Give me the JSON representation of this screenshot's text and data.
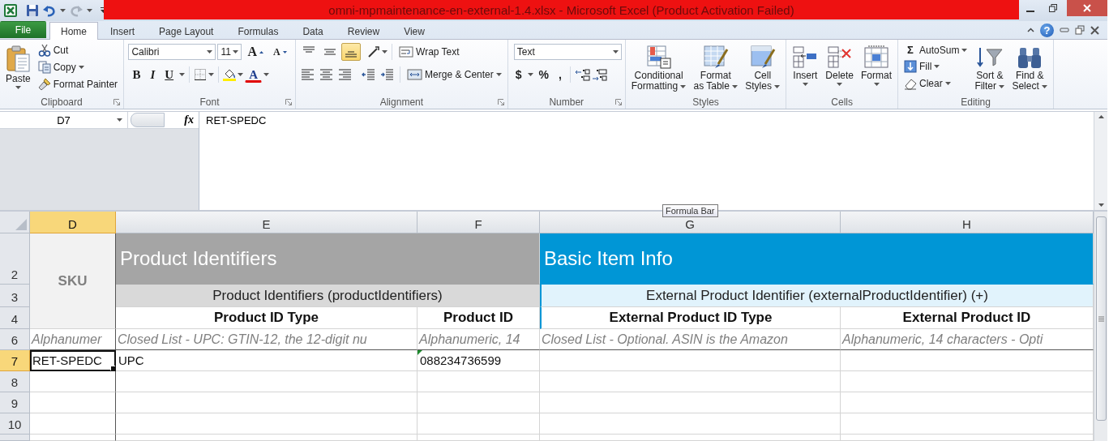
{
  "title_bar": {
    "title": "omni-mpmaintenance-en-external-1.4.xlsx - Microsoft Excel (Product Activation Failed)"
  },
  "ribbon_tabs": [
    {
      "label": "File",
      "kind": "file",
      "selected": false
    },
    {
      "label": "Home",
      "kind": "tab",
      "selected": true
    },
    {
      "label": "Insert",
      "kind": "tab",
      "selected": false
    },
    {
      "label": "Page Layout",
      "kind": "tab",
      "selected": false
    },
    {
      "label": "Formulas",
      "kind": "tab",
      "selected": false
    },
    {
      "label": "Data",
      "kind": "tab",
      "selected": false
    },
    {
      "label": "Review",
      "kind": "tab",
      "selected": false
    },
    {
      "label": "View",
      "kind": "tab",
      "selected": false
    }
  ],
  "help": {
    "label": "?"
  },
  "ribbon_groups": [
    {
      "label": "Clipboard",
      "launcher": true,
      "paste": "Paste",
      "small": [
        "Cut",
        "Copy",
        "Format Painter"
      ]
    },
    {
      "label": "Font",
      "launcher": true,
      "font_name": "Calibri",
      "font_size": "11",
      "grow_font": "A",
      "shrink_font": "A",
      "bold": "B",
      "italic": "I",
      "underline": "U",
      "font_color": "A"
    },
    {
      "label": "Alignment",
      "launcher": true,
      "vertical_align": [
        {
          "selected": false
        },
        {
          "selected": false
        },
        {
          "selected": true
        }
      ],
      "wrap_text": "Wrap Text",
      "merge": "Merge & Center"
    },
    {
      "label": "Number",
      "launcher": true,
      "number_format": "Text",
      "currency": "$",
      "percent": "%",
      "comma": ","
    },
    {
      "label": "Styles",
      "launcher": false,
      "buttons": [
        "Conditional\nFormatting",
        "Format\nas Table",
        "Cell\nStyles"
      ]
    },
    {
      "label": "Cells",
      "launcher": false,
      "buttons": [
        "Insert",
        "Delete",
        "Format"
      ]
    },
    {
      "label": "Editing",
      "launcher": false,
      "autosum_symbol": "Σ",
      "small": [
        "AutoSum",
        "Fill",
        "Clear"
      ],
      "large": [
        "Sort &\nFilter",
        "Find &\nSelect"
      ]
    }
  ],
  "formula_bar": {
    "name_box": "D7",
    "function_label": "fx",
    "formula": "RET-SPEDC",
    "tooltip": "Formula Bar"
  },
  "sheet": {
    "columns": [
      {
        "label": "D",
        "selected": true
      },
      {
        "label": "E",
        "selected": false
      },
      {
        "label": "F",
        "selected": false
      },
      {
        "label": "G",
        "selected": false
      },
      {
        "label": "H",
        "selected": false
      }
    ],
    "rows": [
      {
        "label": "2",
        "selected": false
      },
      {
        "label": "3",
        "selected": false
      },
      {
        "label": "4",
        "selected": false
      },
      {
        "label": "6",
        "selected": false
      },
      {
        "label": "7",
        "selected": true
      },
      {
        "label": "8",
        "selected": false
      },
      {
        "label": "9",
        "selected": false
      },
      {
        "label": "10",
        "selected": false
      }
    ],
    "sku_header": "SKU",
    "sections": [
      {
        "text": "Product Identifiers",
        "color": "#a5a5a5"
      },
      {
        "text": "Basic Item Info",
        "color": "#0096d6"
      }
    ],
    "groups": [
      {
        "text": "Product Identifiers (productIdentifiers)",
        "color": "#d9d9d9"
      },
      {
        "text": "External Product Identifier (externalProductIdentifier) (+)",
        "color": "#e1f3fc"
      }
    ],
    "field_headers": [
      "Product ID Type",
      "Product ID",
      "External Product ID Type",
      "External Product ID"
    ],
    "descriptions": [
      "Alphanumer",
      "Closed List - UPC: GTIN-12, the 12-digit nu",
      "Alphanumeric, 14",
      "Closed List - Optional. ASIN is the Amazon",
      "Alphanumeric, 14 characters - Opti"
    ],
    "data_cells": [
      {
        "text": "RET-SPEDC",
        "selected": true,
        "error_flag": false
      },
      {
        "text": "UPC",
        "selected": false,
        "error_flag": false
      },
      {
        "text": "088234736599",
        "selected": false,
        "error_flag": true
      }
    ]
  }
}
